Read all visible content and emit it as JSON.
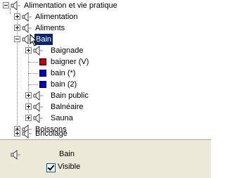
{
  "tree": {
    "items": [
      {
        "label": "Alimentation et vie pratique"
      },
      {
        "label": "Alimentation"
      },
      {
        "label": "Aliments"
      },
      {
        "label": "Bain"
      },
      {
        "label": "Baignade"
      },
      {
        "label": "baigner (V)"
      },
      {
        "label": "bain (*)"
      },
      {
        "label": "bain (2)"
      },
      {
        "label": "Bain public"
      },
      {
        "label": "Balnéaire"
      },
      {
        "label": "Sauna"
      },
      {
        "label": "Boissons"
      },
      {
        "label": "Bricolage"
      }
    ]
  },
  "details": {
    "name": "Bain",
    "visible_label": "Visible",
    "visible_checked": true
  },
  "colors": {
    "selection": "#0a246a",
    "red_square": "#c00000",
    "blue_square": "#0000cc",
    "panel_bg": "#ece9d8"
  }
}
